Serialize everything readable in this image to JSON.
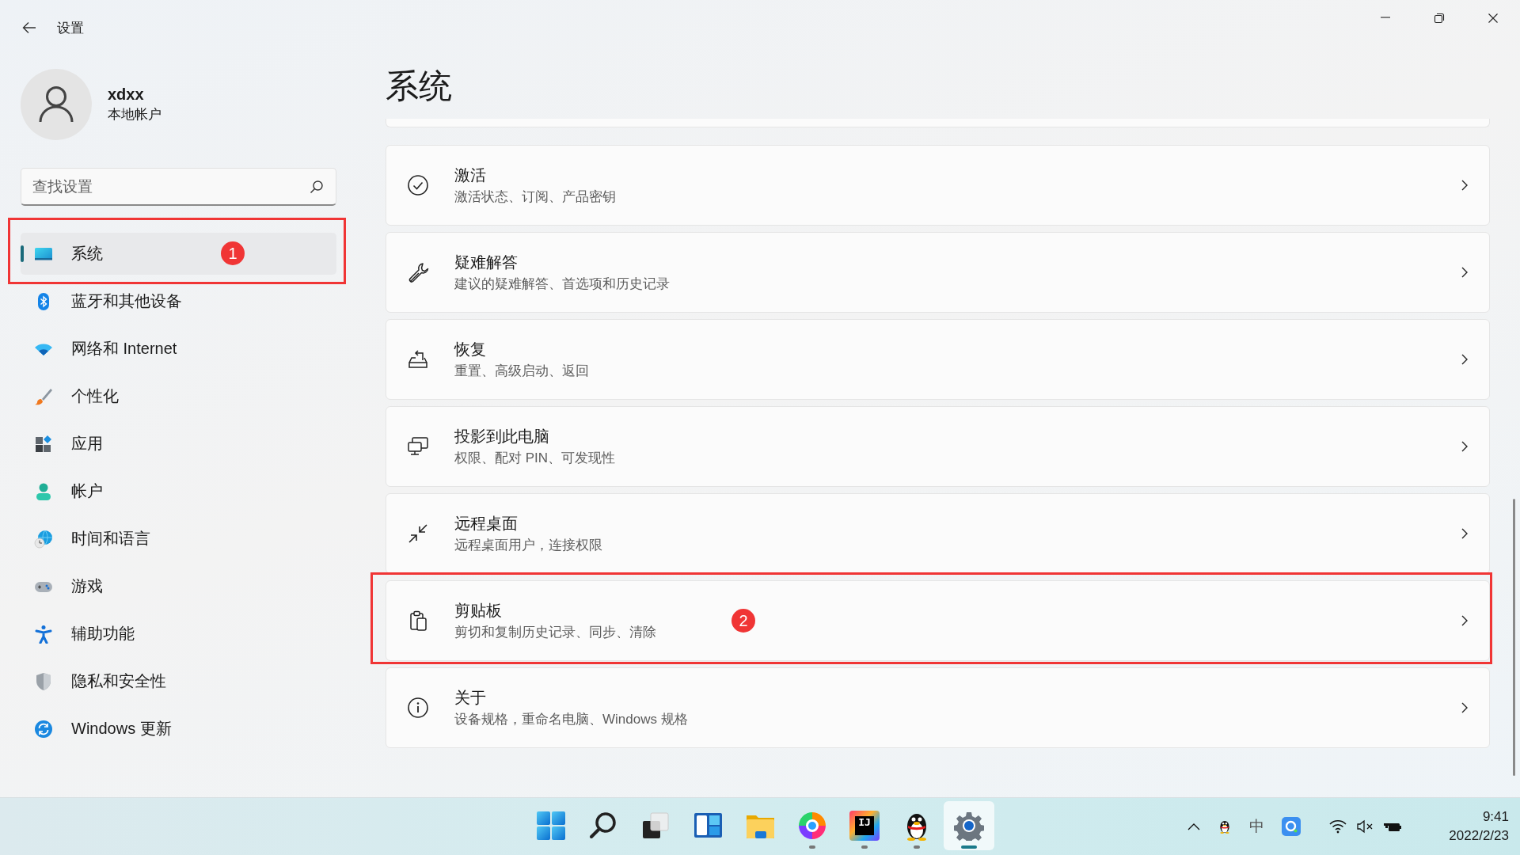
{
  "window": {
    "title": "设置"
  },
  "account": {
    "name": "xdxx",
    "type": "本地帐户"
  },
  "search": {
    "placeholder": "查找设置"
  },
  "sidebar": {
    "items": [
      {
        "label": "系统",
        "selected": true,
        "callout": "1"
      },
      {
        "label": "蓝牙和其他设备",
        "selected": false
      },
      {
        "label": "网络和 Internet",
        "selected": false
      },
      {
        "label": "个性化",
        "selected": false
      },
      {
        "label": "应用",
        "selected": false
      },
      {
        "label": "帐户",
        "selected": false
      },
      {
        "label": "时间和语言",
        "selected": false
      },
      {
        "label": "游戏",
        "selected": false
      },
      {
        "label": "辅助功能",
        "selected": false
      },
      {
        "label": "隐私和安全性",
        "selected": false
      },
      {
        "label": "Windows 更新",
        "selected": false
      }
    ]
  },
  "page": {
    "title": "系统",
    "cards": [
      {
        "title": "激活",
        "description": "激活状态、订阅、产品密钥"
      },
      {
        "title": "疑难解答",
        "description": "建议的疑难解答、首选项和历史记录"
      },
      {
        "title": "恢复",
        "description": "重置、高级启动、返回"
      },
      {
        "title": "投影到此电脑",
        "description": "权限、配对 PIN、可发现性"
      },
      {
        "title": "远程桌面",
        "description": "远程桌面用户，连接权限"
      },
      {
        "title": "剪贴板",
        "description": "剪切和复制历史记录、同步、清除",
        "callout": "2"
      },
      {
        "title": "关于",
        "description": "设备规格，重命名电脑、Windows 规格"
      }
    ]
  },
  "taskbar": {
    "apps": [
      {
        "running": false,
        "selected": false
      },
      {
        "running": false,
        "selected": false
      },
      {
        "running": false,
        "selected": false
      },
      {
        "running": false,
        "selected": false
      },
      {
        "running": false,
        "selected": false
      },
      {
        "running": true,
        "selected": false
      },
      {
        "running": true,
        "selected": false,
        "label": "IJ"
      },
      {
        "running": true,
        "selected": false
      },
      {
        "running": true,
        "selected": true
      }
    ],
    "input_method": "中",
    "clock": {
      "time": "9:41",
      "date": "2022/2/23"
    }
  }
}
